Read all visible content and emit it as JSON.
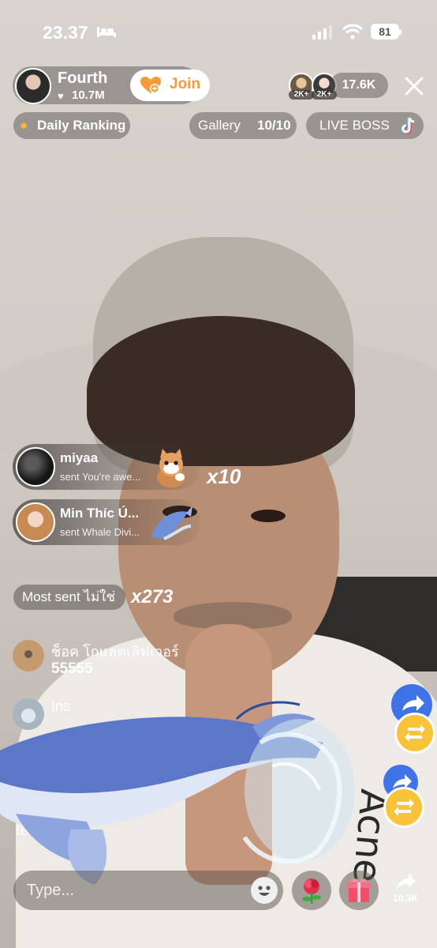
{
  "status_bar": {
    "time": "23.37",
    "battery": "81"
  },
  "host": {
    "name": "Fourth",
    "likes": "10.7M",
    "join_label": "Join"
  },
  "viewers": {
    "top_badges": [
      "2K+",
      "2K+"
    ],
    "count": "17.6K"
  },
  "chips": {
    "daily_ranking": "Daily Ranking",
    "gallery_label": "Gallery",
    "gallery_count": "10/10",
    "live_boss": "LIVE BOSS"
  },
  "gifts": [
    {
      "user": "miyaa",
      "message": "sent You're awe...",
      "count": "x10"
    },
    {
      "user": "Min Thíc Ú...",
      "message": "sent Whale Divi...",
      "count": ""
    }
  ],
  "most_sent": {
    "label": "Most sent ไม่ใช่",
    "count": "x273"
  },
  "comments": [
    {
      "user": "ช็อค โกแลตเลิฟเวอร์",
      "text": "55555"
    },
    {
      "user": "Ins",
      "text": ""
    }
  ],
  "faded_text": "ted",
  "bottom_bar": {
    "placeholder": "Type...",
    "share_count": "10.3K"
  },
  "colors": {
    "join_orange": "#f59b3b",
    "share_blue": "#3f73e8",
    "repost_yellow": "#f8c23a"
  }
}
